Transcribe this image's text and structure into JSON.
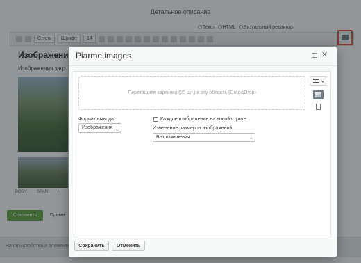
{
  "background": {
    "heading": "Детальное описание",
    "editor_modes": [
      "Текст",
      "HTML",
      "Визуальный редактор"
    ],
    "toolbar": {
      "style_select": "Стиль",
      "font_select": "Шрифт",
      "size_select": "14"
    },
    "article_title": "Изображения",
    "article_text": "Изображения загр",
    "tags": [
      "BODY",
      "SPAN",
      "H"
    ],
    "save_button": "Сохранить",
    "apply_button": "Приме",
    "bottom_text": "Начать свойства и элементы"
  },
  "dialog": {
    "title": "Piarme images",
    "dropzone_text": "Перетащите картинки (20 шт.) в эту область (Drag&Drop)",
    "format_label": "Формат вывода",
    "format_value": "Изображения",
    "newline_checkbox_label": "Каждое изображение на новой строке",
    "newline_checked": false,
    "resize_label": "Изменение размеров изображений",
    "resize_value": "Без изменения",
    "save_button": "Сохранить",
    "cancel_button": "Отменить"
  },
  "colors": {
    "save_green": "#5fa840",
    "highlight_red": "#e74c3c",
    "overlay": "rgba(30,35,40,0.48)"
  }
}
